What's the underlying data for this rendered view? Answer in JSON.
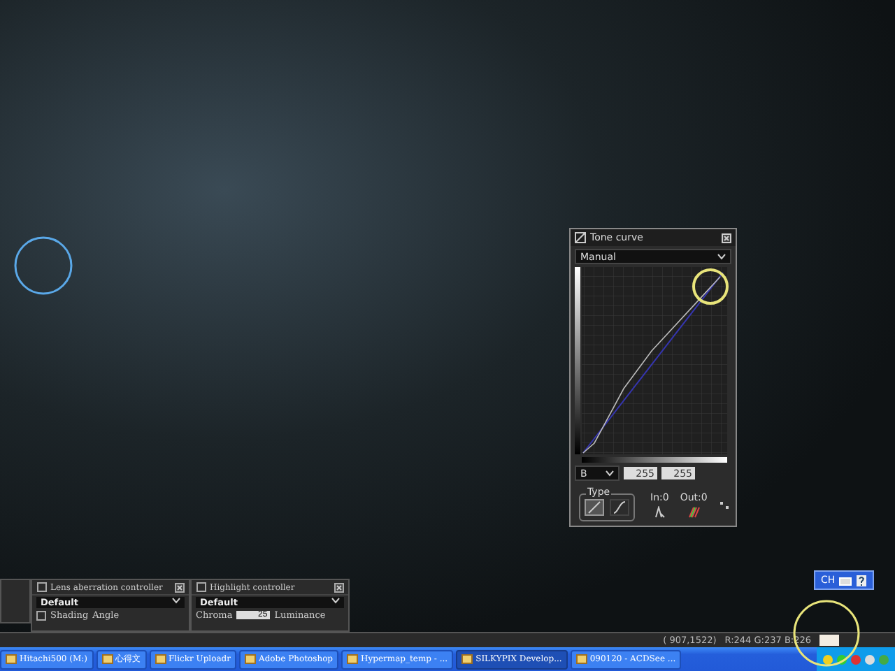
{
  "tone_curve": {
    "title": "Tone curve",
    "preset": "Manual",
    "channel": "B",
    "input_value": "255",
    "output_value": "255",
    "in_label": "In:0",
    "out_label": "Out:0",
    "type_label": "Type",
    "types": [
      {
        "kind": "linear",
        "selected": true
      },
      {
        "kind": "spline",
        "selected": false
      }
    ]
  },
  "panels": [
    {
      "kind": "lens",
      "title": "Lens aberration controller",
      "preset": "Default",
      "checkbox": {
        "label": "Shading",
        "checked": false
      },
      "label": "Angle"
    },
    {
      "kind": "highlight",
      "title": "Highlight controller",
      "preset": "Default",
      "label": "Chroma",
      "value": "25",
      "extra_label": "Luminance"
    }
  ],
  "ime_bar": {
    "label": "CH"
  },
  "status": {
    "coords": "( 907,1522)",
    "readout": "R:244 G:237 B:226"
  },
  "taskbar": {
    "items": [
      {
        "label": "Hitachi500 (M:)",
        "selected": false
      },
      {
        "label": "心得文",
        "selected": false
      },
      {
        "label": "Flickr Uploadr",
        "selected": false
      },
      {
        "label": "Adobe Photoshop",
        "selected": false
      },
      {
        "label": "Hypermap_temp - ...",
        "selected": false
      },
      {
        "label": "SILKYPIX Develop...",
        "selected": true
      },
      {
        "label": "090120 - ACDSee ...",
        "selected": false
      }
    ]
  }
}
